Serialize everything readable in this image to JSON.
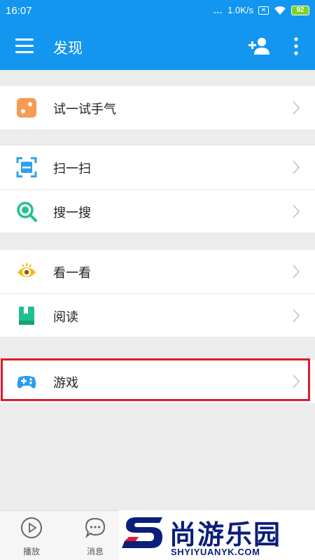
{
  "status_bar": {
    "time": "16:07",
    "signal": "...",
    "speed": "1.0K/s",
    "battery": "92"
  },
  "header": {
    "title": "发现",
    "icons": [
      "menu-icon",
      "add-user-icon",
      "more-icon"
    ]
  },
  "groups": [
    {
      "items": [
        {
          "label": "试一试手气",
          "icon": "dice-icon",
          "color": "#f79b54"
        }
      ]
    },
    {
      "items": [
        {
          "label": "扫一扫",
          "icon": "scan-icon",
          "color": "#2fa0e9"
        },
        {
          "label": "搜一搜",
          "icon": "search-icon",
          "color": "#23c08f"
        }
      ]
    },
    {
      "items": [
        {
          "label": "看一看",
          "icon": "eye-icon",
          "color": "#f6b800"
        },
        {
          "label": "阅读",
          "icon": "book-icon",
          "color": "#1fbf8f"
        }
      ]
    },
    {
      "items": [
        {
          "label": "游戏",
          "icon": "gamepad-icon",
          "color": "#2b9cf0"
        }
      ]
    }
  ],
  "highlight_color": "#e01b2c",
  "bottom_tabs": [
    {
      "label": "播放",
      "icon": "play-icon"
    },
    {
      "label": "消息",
      "icon": "message-icon"
    }
  ],
  "watermark": {
    "name": "尚游乐园",
    "url": "SHYIYUANYK.COM"
  },
  "colors": {
    "primary": "#1296f0",
    "background": "#ececec"
  }
}
